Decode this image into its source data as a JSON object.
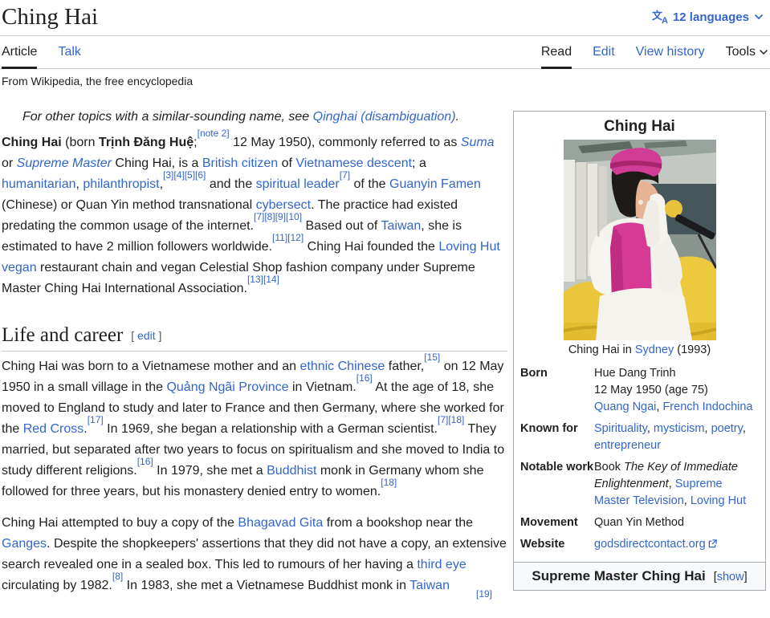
{
  "theme": {
    "link_color": "#3366cc",
    "text_color": "#202122",
    "border_color": "#a2a9b1",
    "active_tab_underline": "#202122"
  },
  "header": {
    "title": "Ching Hai",
    "languages_label": "12 languages"
  },
  "tabs": {
    "left": [
      {
        "label": "Article",
        "active": true
      },
      {
        "label": "Talk",
        "active": false
      }
    ],
    "right": [
      {
        "label": "Read",
        "active": true
      },
      {
        "label": "Edit",
        "active": false
      },
      {
        "label": "View history",
        "active": false
      },
      {
        "label": "Tools",
        "active": false
      }
    ]
  },
  "tagline": "From Wikipedia, the free encyclopedia",
  "hatnote": [
    {
      "t": "For other topics with a similar-sounding name, see "
    },
    {
      "t": "Qinghai (disambiguation)",
      "s": "link"
    },
    {
      "t": "."
    }
  ],
  "lead": [
    {
      "t": "Ching Hai",
      "s": "bold"
    },
    {
      "t": " (born "
    },
    {
      "t": "Trịnh Đăng Huệ",
      "s": "bold"
    },
    {
      "t": ";"
    },
    {
      "t": "[note 2]",
      "s": "sup"
    },
    {
      "t": " 12 May 1950), commonly referred to as "
    },
    {
      "t": "Suma",
      "s": "link-italic"
    },
    {
      "t": " or "
    },
    {
      "t": "Supreme Master",
      "s": "link-italic"
    },
    {
      "t": " Ching Hai, is a "
    },
    {
      "t": "British citizen",
      "s": "link"
    },
    {
      "t": " of "
    },
    {
      "t": "Vietnamese descent",
      "s": "link"
    },
    {
      "t": "; a "
    },
    {
      "t": "humanitarian",
      "s": "link"
    },
    {
      "t": ", "
    },
    {
      "t": "philanthropist",
      "s": "link"
    },
    {
      "t": ","
    },
    {
      "t": "[3][4][5][6]",
      "s": "sup"
    },
    {
      "t": " and the "
    },
    {
      "t": "spiritual leader",
      "s": "link"
    },
    {
      "t": "[7]",
      "s": "sup"
    },
    {
      "t": " of the "
    },
    {
      "t": "Guanyin Famen",
      "s": "link"
    },
    {
      "t": " (Chinese) or Quan Yin method transnational "
    },
    {
      "t": "cybersect",
      "s": "link"
    },
    {
      "t": ". The practice had existed predating the common usage of the internet."
    },
    {
      "t": "[7][8][9][10]",
      "s": "sup"
    },
    {
      "t": " Based out of "
    },
    {
      "t": "Taiwan",
      "s": "link"
    },
    {
      "t": ", she is estimated to have 2 million followers worldwide."
    },
    {
      "t": "[11][12]",
      "s": "sup"
    },
    {
      "t": " Ching Hai founded the "
    },
    {
      "t": "Loving Hut",
      "s": "link"
    },
    {
      "t": " "
    },
    {
      "t": "vegan",
      "s": "link"
    },
    {
      "t": " restaurant chain and vegan Celestial Shop fashion company under Supreme Master Ching Hai International Association."
    },
    {
      "t": "[13][14]",
      "s": "sup"
    }
  ],
  "section": {
    "title": "Life and career",
    "bracket_open": "[",
    "edit_label": "edit",
    "bracket_close": "]"
  },
  "paragraphs": {
    "p2": [
      {
        "t": "Ching Hai was born to a Vietnamese mother and an "
      },
      {
        "t": "ethnic Chinese",
        "s": "link"
      },
      {
        "t": " father,"
      },
      {
        "t": "[15]",
        "s": "sup"
      },
      {
        "t": " on 12 May 1950 in a small village in the "
      },
      {
        "t": "Quảng Ngãi Province",
        "s": "link"
      },
      {
        "t": " in Vietnam."
      },
      {
        "t": "[16]",
        "s": "sup"
      },
      {
        "t": " At the age of 18, she moved to England to study and later to France and then Germany, where she worked for the "
      },
      {
        "t": "Red Cross",
        "s": "link"
      },
      {
        "t": "."
      },
      {
        "t": "[17]",
        "s": "sup"
      },
      {
        "t": " In 1969, she began a relationship with a German scientist."
      },
      {
        "t": "[7][18]",
        "s": "sup"
      },
      {
        "t": " They married, but separated after two years to focus on spiritualism and she moved to India to study different religions."
      },
      {
        "t": "[16]",
        "s": "sup"
      },
      {
        "t": " In 1979, she met a "
      },
      {
        "t": "Buddhist",
        "s": "link"
      },
      {
        "t": " monk in Germany whom she followed for three years, but his monastery denied entry to women."
      },
      {
        "t": "[18]",
        "s": "sup"
      }
    ],
    "p3": [
      {
        "t": "Ching Hai attempted to buy a copy of the "
      },
      {
        "t": "Bhagavad Gita",
        "s": "link"
      },
      {
        "t": " from a bookshop near the "
      },
      {
        "t": "Ganges",
        "s": "link"
      },
      {
        "t": ". Despite the shopkeepers' assertions that they did not have a copy, an extensive search revealed one in a sealed box. This led to rumours of her having a "
      },
      {
        "t": "third eye",
        "s": "link"
      },
      {
        "t": " circulating by 1982."
      },
      {
        "t": "[8]",
        "s": "sup"
      },
      {
        "t": " In 1983, she met a Vietnamese Buddhist monk in "
      },
      {
        "t": "Taiwan",
        "s": "link"
      }
    ]
  },
  "cutoff_ref": "[19]",
  "infobox": {
    "title": "Ching Hai",
    "image_alt": "portrait-photo-ching-hai-speaking-into-microphone",
    "caption": [
      {
        "t": "Ching Hai in "
      },
      {
        "t": "Sydney",
        "s": "link"
      },
      {
        "t": " (1993)"
      }
    ],
    "rows": [
      {
        "label": "Born",
        "value": [
          [
            {
              "t": "Hue Dang Trinh"
            }
          ],
          [
            {
              "t": "12 May 1950 (age 75)"
            }
          ],
          [
            {
              "t": "Quang Ngai",
              "s": "link"
            },
            {
              "t": ", "
            },
            {
              "t": "French Indochina",
              "s": "link"
            }
          ]
        ]
      },
      {
        "label": "Known for",
        "value": [
          [
            {
              "t": "Spirituality",
              "s": "link"
            },
            {
              "t": ", "
            },
            {
              "t": "mysticism",
              "s": "link"
            },
            {
              "t": ", "
            },
            {
              "t": "poetry",
              "s": "link"
            },
            {
              "t": ", "
            },
            {
              "t": "entrepreneur",
              "s": "link"
            }
          ]
        ]
      },
      {
        "label": "Notable work",
        "value": [
          [
            {
              "t": "Book "
            },
            {
              "t": "The Key of Immediate Enlightenment",
              "s": "italic"
            },
            {
              "t": ", "
            },
            {
              "t": "Supreme Master Television",
              "s": "link"
            },
            {
              "t": ", "
            },
            {
              "t": "Loving Hut",
              "s": "link"
            }
          ]
        ]
      },
      {
        "label": "Movement",
        "value": [
          [
            {
              "t": "Quan Yin Method"
            }
          ]
        ]
      },
      {
        "label": "Website",
        "value": [
          [
            {
              "t": "godsdirectcontact.org",
              "s": "link"
            },
            {
              "s": "ext"
            }
          ]
        ]
      }
    ]
  },
  "navbox": {
    "title": "Supreme Master Ching Hai",
    "bracket_open": "[",
    "show_label": "show",
    "bracket_close": "]"
  }
}
